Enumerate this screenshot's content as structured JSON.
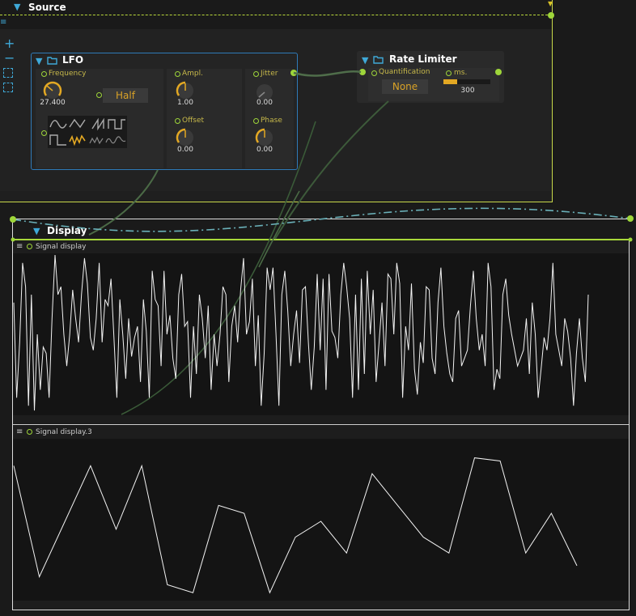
{
  "groups": {
    "source": {
      "title": "Source"
    },
    "display": {
      "title": "Display"
    }
  },
  "toolbar": {
    "add": "+",
    "remove": "−"
  },
  "lfo": {
    "title": "LFO",
    "frequency": {
      "label": "Frequency",
      "value": "27.400"
    },
    "mode_button": "Half",
    "amplitude": {
      "label": "Ampl.",
      "value": "1.00"
    },
    "offset": {
      "label": "Offset",
      "value": "0.00"
    },
    "jitter": {
      "label": "Jitter",
      "value": "0.00"
    },
    "phase": {
      "label": "Phase",
      "value": "0.00"
    }
  },
  "rate_limiter": {
    "title": "Rate Limiter",
    "quantification": {
      "label": "Quantification",
      "value": "None"
    },
    "ms": {
      "label": "ms.",
      "value": "300",
      "fill": 0.3
    }
  },
  "signal_display_1": {
    "title": "Signal display",
    "y": [
      0.7,
      0.1,
      0.45,
      0.95,
      0.8,
      0.05,
      0.75,
      0.02,
      0.5,
      0.15,
      0.42,
      0.38,
      0.1,
      0.6,
      1.0,
      0.75,
      0.8,
      0.5,
      0.3,
      0.5,
      0.78,
      0.6,
      0.45,
      0.75,
      0.98,
      0.82,
      0.48,
      0.4,
      0.6,
      0.95,
      0.45,
      0.72,
      0.68,
      0.85,
      0.48,
      0.1,
      0.72,
      0.5,
      0.22,
      0.6,
      0.36,
      0.48,
      0.55,
      0.2,
      0.72,
      0.52,
      0.1,
      0.9,
      0.72,
      0.68,
      0.3,
      0.9,
      0.5,
      0.62,
      0.35,
      0.22,
      0.75,
      0.88,
      0.55,
      0.58,
      0.1,
      0.55,
      0.25,
      0.75,
      0.6,
      0.35,
      0.68,
      0.15,
      0.5,
      0.3,
      0.5,
      0.8,
      0.75,
      0.2,
      0.55,
      0.68,
      0.45,
      0.78,
      0.98,
      0.5,
      0.58,
      0.85,
      0.3,
      0.62,
      0.05,
      0.38,
      0.92,
      0.78,
      0.92,
      0.5,
      0.05,
      0.75,
      0.9,
      0.65,
      0.3,
      0.5,
      0.65,
      0.32,
      0.78,
      0.8,
      0.45,
      0.15,
      0.42,
      0.88,
      0.4,
      0.85,
      0.15,
      0.88,
      0.52,
      0.48,
      0.35,
      0.75,
      0.95,
      0.8,
      0.6,
      0.1,
      0.75,
      0.15,
      0.85,
      0.25,
      0.9,
      0.5,
      0.78,
      0.2,
      0.45,
      0.7,
      0.3,
      0.88,
      0.85,
      0.5,
      0.95,
      0.82,
      0.1,
      0.55,
      0.4,
      0.82,
      0.28,
      0.12,
      0.45,
      0.32,
      0.8,
      0.78,
      0.35,
      0.25,
      0.7,
      0.92,
      0.55,
      0.38,
      0.25,
      0.2,
      0.6,
      0.65,
      0.3,
      0.35,
      0.4,
      0.68,
      0.9,
      0.6,
      0.4,
      0.5,
      0.3,
      0.95,
      0.8,
      0.15,
      0.28,
      0.22,
      0.75,
      0.85,
      0.62,
      0.5,
      0.4,
      0.3,
      0.35,
      0.4,
      0.6,
      0.25,
      0.7,
      0.5,
      0.1,
      0.28,
      0.48,
      0.4,
      0.6,
      0.95,
      0.5,
      0.4,
      0.3,
      0.6,
      0.52,
      0.35,
      0.05,
      0.38,
      0.6,
      0.35,
      0.2,
      0.75
    ]
  },
  "signal_display_2": {
    "title": "Signal display.3",
    "y": [
      0.85,
      0.15,
      0.5,
      0.85,
      0.45,
      0.85,
      0.1,
      0.05,
      0.6,
      0.55,
      0.05,
      0.4,
      0.5,
      0.3,
      0.8,
      0.6,
      0.4,
      0.3,
      0.9,
      0.88,
      0.3,
      0.55,
      0.22
    ]
  }
}
